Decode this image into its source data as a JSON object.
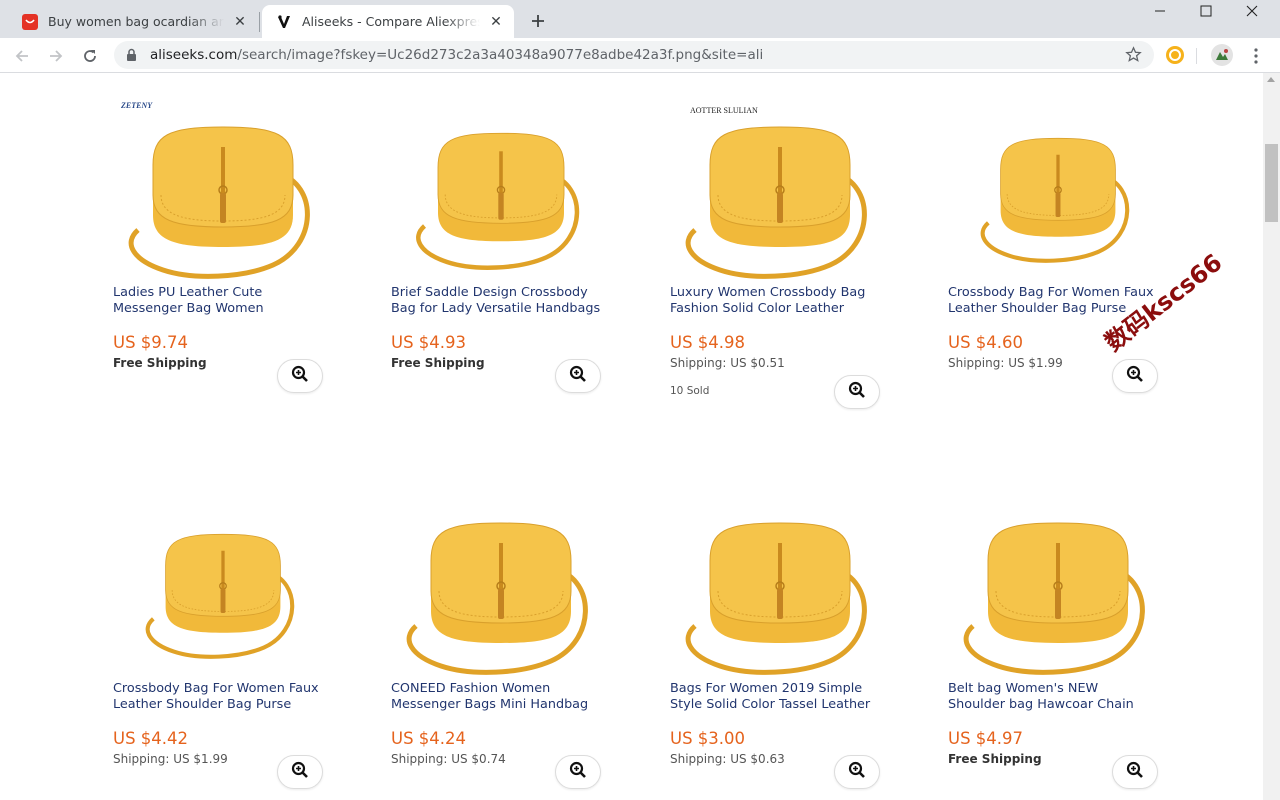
{
  "browser": {
    "tabs": [
      {
        "title": "Buy women bag ocardian and get free shipping on AliExpress",
        "active": false
      },
      {
        "title": "Aliseeks - Compare Aliexpress products",
        "active": true
      }
    ],
    "url_host": "aliseeks.com",
    "url_path": "/search/image?fskey=Uc26d273c2a3a40348a9077e8adbe42a3f.png&site=ali"
  },
  "products": [
    {
      "brand": "ZETENY",
      "title_line1": "Ladies PU Leather Cute",
      "title_line2": "Messenger Bag Women",
      "price": "US $9.74",
      "shipping": "Free Shipping",
      "free": true,
      "sold": ""
    },
    {
      "brand": "",
      "title_line1": "Brief Saddle Design Crossbody",
      "title_line2": "Bag for Lady Versatile Handbags",
      "price": "US $4.93",
      "shipping": "Free Shipping",
      "free": true,
      "sold": ""
    },
    {
      "brand": "AOTTER SLULIAN",
      "title_line1": "Luxury Women Crossbody Bag",
      "title_line2": "Fashion Solid Color Leather",
      "price": "US $4.98",
      "shipping": "Shipping: US $0.51",
      "free": false,
      "sold": "10 Sold"
    },
    {
      "brand": "",
      "title_line1": "Crossbody Bag For Women Faux",
      "title_line2": "Leather Shoulder Bag Purse",
      "price": "US $4.60",
      "shipping": "Shipping: US $1.99",
      "free": false,
      "sold": ""
    },
    {
      "brand": "",
      "title_line1": "Crossbody Bag For Women Faux",
      "title_line2": "Leather Shoulder Bag Purse",
      "price": "US $4.42",
      "shipping": "Shipping: US $1.99",
      "free": false,
      "sold": ""
    },
    {
      "brand": "",
      "title_line1": "CONEED Fashion Women",
      "title_line2": "Messenger Bags Mini Handbag",
      "price": "US $4.24",
      "shipping": "Shipping: US $0.74",
      "free": false,
      "sold": ""
    },
    {
      "brand": "",
      "title_line1": "Bags For Women 2019 Simple",
      "title_line2": "Style Solid Color Tassel Leather",
      "price": "US $3.00",
      "shipping": "Shipping: US $0.63",
      "free": false,
      "sold": ""
    },
    {
      "brand": "",
      "title_line1": "Belt bag Women's NEW",
      "title_line2": "Shoulder bag Hawcoar Chain",
      "price": "US $4.97",
      "shipping": "Free Shipping",
      "free": true,
      "sold": ""
    }
  ],
  "watermark": "数码kscs66",
  "colors": {
    "price": "#e5631d",
    "title": "#21356e",
    "bag": "#f1b93a"
  }
}
